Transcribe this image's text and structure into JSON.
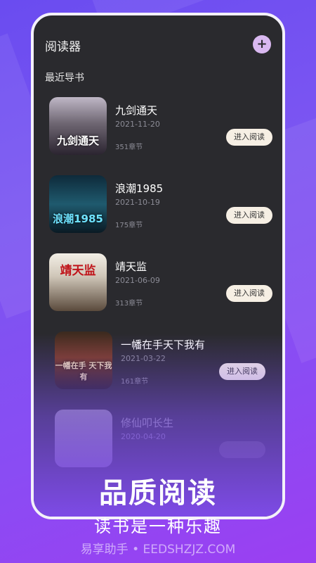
{
  "app": {
    "title": "阅读器",
    "add_icon": "plus-icon",
    "add_symbol": "+"
  },
  "section": {
    "title": "最近导书"
  },
  "books": [
    {
      "title": "九剑通天",
      "date": "2021-11-20",
      "chapters": "351章节",
      "button": "进入阅读",
      "cover_text": "九剑通天"
    },
    {
      "title": "浪潮1985",
      "date": "2021-10-19",
      "chapters": "175章节",
      "button": "进入阅读",
      "cover_text": "浪潮1985"
    },
    {
      "title": "靖天监",
      "date": "2021-06-09",
      "chapters": "313章节",
      "button": "进入阅读",
      "cover_text": "靖天监"
    },
    {
      "title": "一幡在手天下我有",
      "date": "2021-03-22",
      "chapters": "161章节",
      "button": "进入阅读",
      "cover_text": "一幡在手 天下我有"
    },
    {
      "title": "修仙叩长生",
      "date": "2020-04-20",
      "chapters": "",
      "button": "",
      "cover_text": ""
    }
  ],
  "promo": {
    "headline": "品质阅读",
    "subtitle": "读书是一种乐趣"
  },
  "watermark": "易享助手 • EEDSHZJZ.COM",
  "colors": {
    "accent": "#7b55f2",
    "card": "#2a2a2e",
    "button": "#f6efe4"
  }
}
